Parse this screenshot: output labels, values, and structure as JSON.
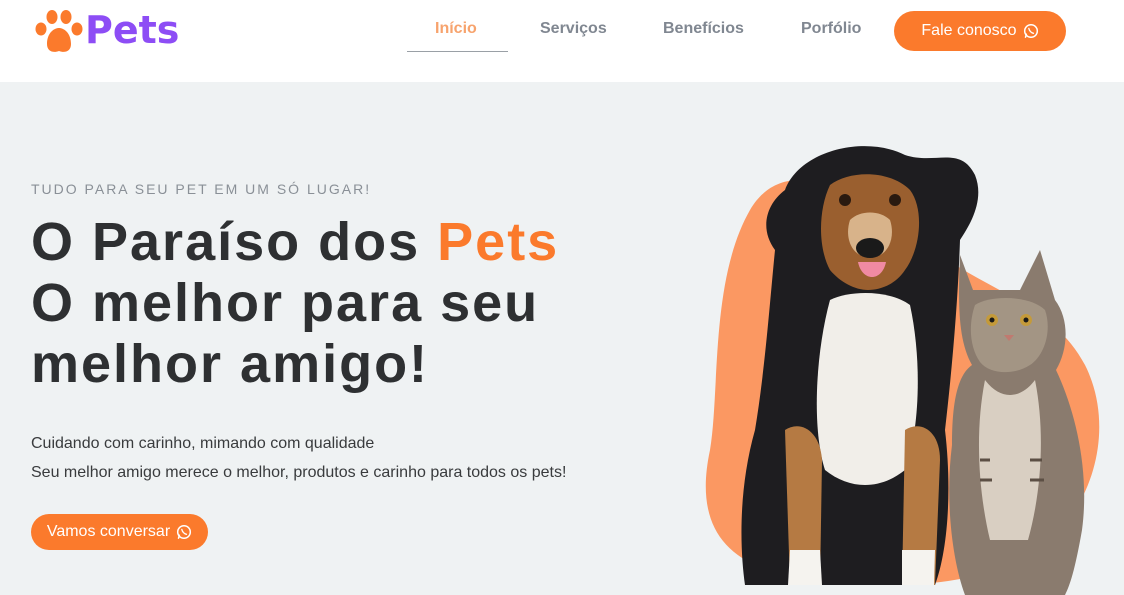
{
  "brand": {
    "name": "Pets"
  },
  "nav": {
    "items": [
      {
        "label": "Início",
        "active": true
      },
      {
        "label": "Serviços",
        "active": false
      },
      {
        "label": "Benefícios",
        "active": false
      },
      {
        "label": "Porfólio",
        "active": false
      }
    ],
    "cta_label": "Fale conosco"
  },
  "hero": {
    "eyebrow": "TUDO PARA SEU PET EM UM SÓ LUGAR!",
    "title_prefix": "O Paraíso dos ",
    "title_accent": "Pets",
    "title_line2": "O melhor para seu",
    "title_line3": "melhor amigo!",
    "sub_line1": "Cuidando com carinho, mimando com qualidade",
    "sub_line2": "Seu melhor amigo merece o melhor, produtos e carinho para todos os pets!",
    "cta_label": "Vamos conversar"
  },
  "colors": {
    "accent": "#fb7a2c",
    "brand": "#8d4df5",
    "active_nav": "#f7a36d",
    "background": "#eff2f3"
  },
  "icons": [
    "paw-logo-icon",
    "whatsapp-icon"
  ]
}
